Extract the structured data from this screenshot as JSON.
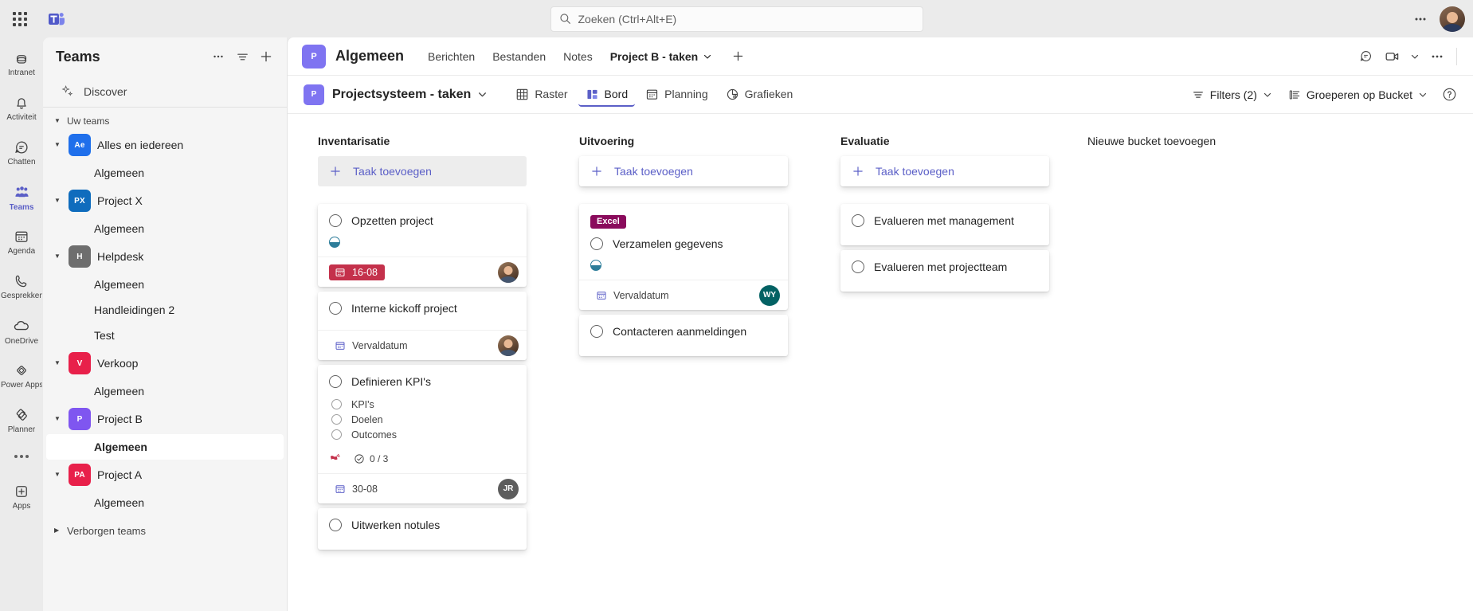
{
  "topbar": {
    "waffle_label": "App-startprogramma",
    "app_name": "Microsoft Teams",
    "search": {
      "placeholder": "Zoeken (Ctrl+Alt+E)",
      "value": ""
    },
    "more_label": "Meer opties",
    "avatar_label": "Account"
  },
  "rail": {
    "items": [
      {
        "label": "Intranet",
        "icon": "intranet-icon",
        "active": false
      },
      {
        "label": "Activiteit",
        "icon": "bell-icon",
        "active": false
      },
      {
        "label": "Chatten",
        "icon": "chat-icon",
        "active": false
      },
      {
        "label": "Teams",
        "icon": "teams-icon",
        "active": true
      },
      {
        "label": "Agenda",
        "icon": "calendar-icon",
        "active": false
      },
      {
        "label": "Gesprekken",
        "icon": "phone-icon",
        "active": false
      },
      {
        "label": "OneDrive",
        "icon": "cloud-icon",
        "active": false
      },
      {
        "label": "Power Apps",
        "icon": "powerapps-icon",
        "active": false
      },
      {
        "label": "Planner",
        "icon": "planner-icon",
        "active": false
      }
    ],
    "more_label": "Meer apps",
    "apps_label": "Apps"
  },
  "teams_pane": {
    "title": "Teams",
    "more_label": "Meer opties",
    "filter_label": "Filteren",
    "add_label": "Teams toevoegen",
    "discover_label": "Discover",
    "group_label": "Uw teams",
    "hidden_label": "Verborgen teams",
    "teams": [
      {
        "name": "Alles en iedereen",
        "initials": "Ae",
        "color": "#1f6feb",
        "channels": [
          "Algemeen"
        ]
      },
      {
        "name": "Project X",
        "initials": "PX",
        "color": "#0f6cbd",
        "channels": [
          "Algemeen"
        ]
      },
      {
        "name": "Helpdesk",
        "initials": "H",
        "color": "#6e6e6e",
        "channels": [
          "Algemeen",
          "Handleidingen 2",
          "Test"
        ]
      },
      {
        "name": "Verkoop",
        "initials": "V",
        "color": "#e8204a",
        "channels": [
          "Algemeen"
        ]
      },
      {
        "name": "Project B",
        "initials": "P",
        "color": "#7f56f0",
        "channels": [
          "Algemeen"
        ],
        "selected_channel": "Algemeen"
      },
      {
        "name": "Project A",
        "initials": "PA",
        "color": "#e8204a",
        "channels": [
          "Algemeen"
        ]
      }
    ]
  },
  "channel_header": {
    "avatar_initials": "P",
    "avatar_color": "#7f74f1",
    "title": "Algemeen",
    "tabs": [
      {
        "label": "Berichten",
        "active": false,
        "has_chevron": false
      },
      {
        "label": "Bestanden",
        "active": false,
        "has_chevron": false
      },
      {
        "label": "Notes",
        "active": false,
        "has_chevron": false
      },
      {
        "label": "Project B - taken",
        "active": true,
        "has_chevron": true
      }
    ],
    "add_tab_label": "Een tabblad toevoegen",
    "chat_label": "Chat",
    "meet_label": "Vergaderen",
    "more_label": "Meer opties"
  },
  "planner_toolbar": {
    "plan_avatar_initials": "P",
    "plan_title": "Projectsysteem - taken",
    "views": [
      {
        "label": "Raster",
        "icon": "grid-icon",
        "active": false
      },
      {
        "label": "Bord",
        "icon": "board-icon",
        "active": true
      },
      {
        "label": "Planning",
        "icon": "schedule-icon",
        "active": false
      },
      {
        "label": "Grafieken",
        "icon": "charts-icon",
        "active": false
      }
    ],
    "filters_label": "Filters (2)",
    "group_label": "Groeperen op Bucket",
    "help_label": "Help"
  },
  "board": {
    "add_task_label": "Taak toevoegen",
    "new_bucket_label": "Nieuwe bucket toevoegen",
    "buckets": [
      {
        "name": "Inventarisatie",
        "add_hovered": true,
        "tasks": [
          {
            "title": "Opzetten project",
            "label": null,
            "progress": "in-progress",
            "checklist": null,
            "checklist_count": null,
            "priority": null,
            "due": {
              "text": "16-08",
              "state": "late"
            },
            "assignee": {
              "type": "photo",
              "initials": "",
              "color": ""
            }
          },
          {
            "title": "Interne kickoff project",
            "label": null,
            "progress": null,
            "checklist": null,
            "checklist_count": null,
            "priority": null,
            "due": {
              "text": "Vervaldatum",
              "state": "normal"
            },
            "assignee": {
              "type": "photo",
              "initials": "",
              "color": ""
            }
          },
          {
            "title": "Definieren KPI's",
            "label": null,
            "progress": null,
            "checklist": [
              "KPI's",
              "Doelen",
              "Outcomes"
            ],
            "checklist_count": "0 / 3",
            "priority": "important",
            "due": {
              "text": "30-08",
              "state": "normal"
            },
            "assignee": {
              "type": "initials",
              "initials": "JR",
              "color": "#5d5d5d"
            }
          },
          {
            "title": "Uitwerken notules",
            "label": null,
            "progress": null,
            "checklist": null,
            "checklist_count": null,
            "priority": null,
            "due": null,
            "assignee": null
          }
        ]
      },
      {
        "name": "Uitvoering",
        "add_hovered": false,
        "tasks": [
          {
            "title": "Verzamelen gegevens",
            "label": {
              "text": "Excel",
              "color": "#8a0b5c"
            },
            "progress": "in-progress",
            "checklist": null,
            "checklist_count": null,
            "priority": null,
            "due": {
              "text": "Vervaldatum",
              "state": "normal"
            },
            "assignee": {
              "type": "initials",
              "initials": "WY",
              "color": "#036264"
            }
          },
          {
            "title": "Contacteren aanmeldingen",
            "label": null,
            "progress": null,
            "checklist": null,
            "checklist_count": null,
            "priority": null,
            "due": null,
            "assignee": null
          }
        ]
      },
      {
        "name": "Evaluatie",
        "add_hovered": false,
        "tasks": [
          {
            "title": "Evalueren met management",
            "label": null,
            "progress": null,
            "checklist": null,
            "checklist_count": null,
            "priority": null,
            "due": null,
            "assignee": null
          },
          {
            "title": "Evalueren met projectteam",
            "label": null,
            "progress": null,
            "checklist": null,
            "checklist_count": null,
            "priority": null,
            "due": null,
            "assignee": null
          }
        ]
      }
    ]
  }
}
